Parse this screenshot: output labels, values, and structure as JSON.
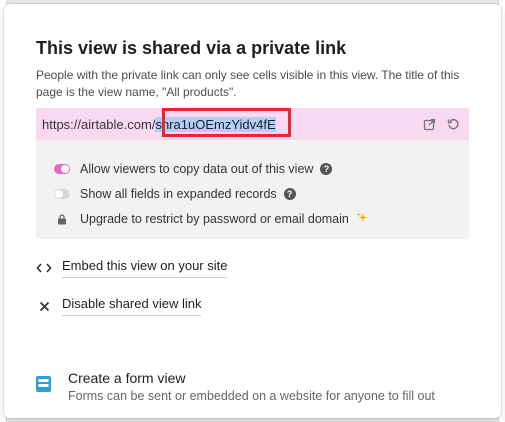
{
  "dialog": {
    "title": "This view is shared via a private link",
    "description": "People with the private link can only see cells visible in this view. The title of this page is the view name, \"All products\"."
  },
  "share_link": {
    "url_prefix": "https://airtable.com/",
    "url_selected": "shra1uOEmzYidv4fE",
    "open_icon": "open-external-icon",
    "regenerate_icon": "regenerate-icon",
    "bar_color": "#f9d9f1",
    "selection_color": "#b2d0f7",
    "highlight_color": "#e8262c"
  },
  "options": [
    {
      "label": "Allow viewers to copy data out of this view",
      "enabled": true,
      "toggle_color": "#e864c8"
    },
    {
      "label": "Show all fields in expanded records",
      "enabled": false,
      "toggle_color": "#d6d6d6"
    },
    {
      "label": "Upgrade to restrict by password or email domain",
      "icon": "lock-icon",
      "upgrade_icon": "sparkle-icon"
    }
  ],
  "actions": {
    "embed": {
      "label": "Embed this view on your site",
      "icon": "code-brackets-icon"
    },
    "disable": {
      "label": "Disable shared view link",
      "icon": "close-icon"
    }
  },
  "form_view": {
    "title": "Create a form view",
    "description": "Forms can be sent or embedded on a website for anyone to fill out",
    "icon": "form-icon",
    "icon_color": "#2d9cdb"
  }
}
